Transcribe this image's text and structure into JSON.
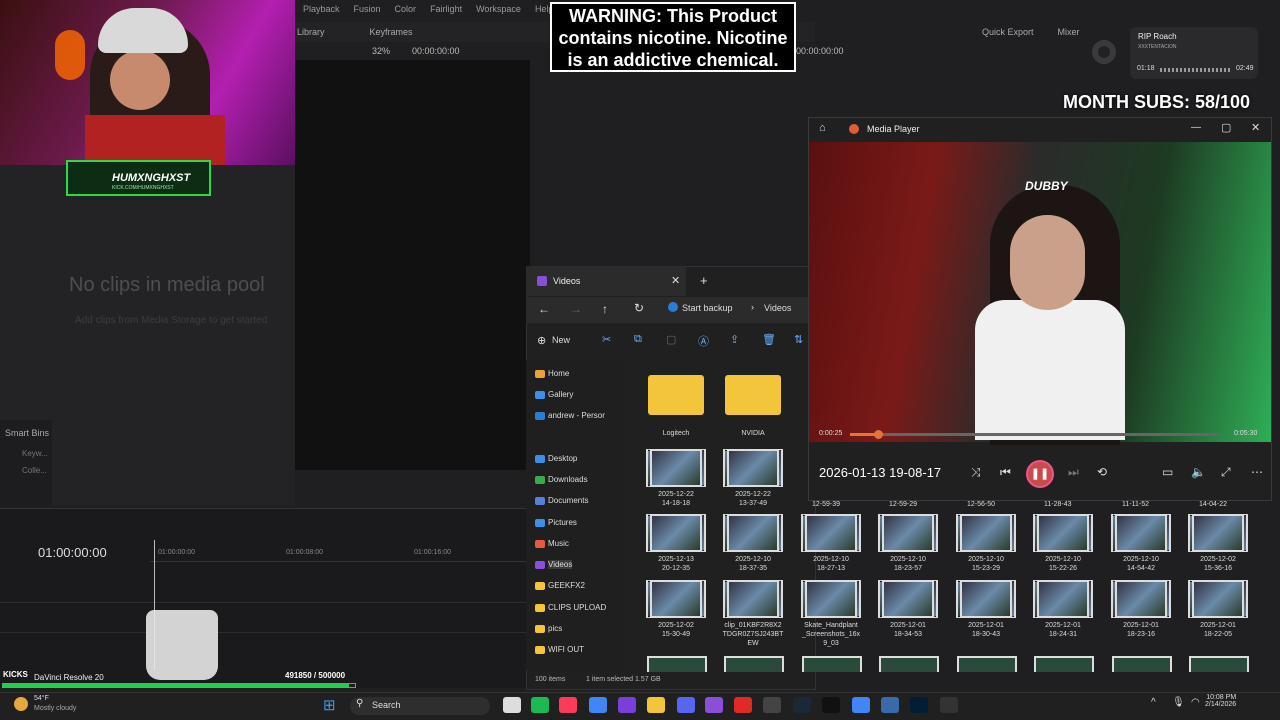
{
  "resolve": {
    "menu": [
      "Playback",
      "Fusion",
      "Color",
      "Fairlight",
      "Workspace",
      "Help"
    ],
    "toolbar": {
      "library": "Library",
      "keyframes": "Keyframes",
      "zoom": "32%",
      "timecode": "00:00:00:00"
    },
    "timecode2": "00:00:00:00",
    "quick_export": "Quick Export",
    "mixer": "Mixer",
    "media_pool_empty": "No clips in media pool",
    "media_pool_hint": "Add clips from Media Storage to get started",
    "smart_bins": "Smart Bins",
    "smart_bin_items": [
      "Keyw...",
      "Colle..."
    ],
    "timeline_tc": "01:00:00:00",
    "ruler": [
      "01:00:00:00",
      "01:00:08:00",
      "01:00:16:00"
    ],
    "app_name": "DaVinci Resolve 20"
  },
  "overlay": {
    "webcam_logo": "HUMXNGHXST",
    "webcam_logo_sub": "KICK.COM/HUMXNGHXST",
    "warning": "WARNING: This Product contains nicotine. Nicotine is an addictive chemical.",
    "month_subs": "MONTH SUBS: 58/100",
    "kick_label": "KICKS",
    "goal_counter": "491850 / 500000",
    "goal_progress": 0.9837
  },
  "spotify": {
    "title": "RIP Roach",
    "artist": "XXXTENTACION",
    "elapsed": "01:18",
    "duration": "02:49"
  },
  "media_player": {
    "title": "Media Player",
    "brand": "DUBBY",
    "current": "0:00:25",
    "duration": "0:05:30",
    "progress": 0.076,
    "file_name": "2026-01-13 19-08-17"
  },
  "explorer": {
    "tab_title": "Videos",
    "address": [
      "Start backup",
      "Videos"
    ],
    "new_label": "New",
    "nav": [
      {
        "label": "Home",
        "color": "#e8a33d"
      },
      {
        "label": "Gallery",
        "color": "#3d8ee8"
      },
      {
        "label": "andrew - Persor",
        "color": "#2b7cd3"
      },
      {
        "label": "Desktop",
        "color": "#3d8ee8"
      },
      {
        "label": "Downloads",
        "color": "#3da84e"
      },
      {
        "label": "Documents",
        "color": "#5a7fd8"
      },
      {
        "label": "Pictures",
        "color": "#3d8ee8"
      },
      {
        "label": "Music",
        "color": "#e85a3d"
      },
      {
        "label": "Videos",
        "color": "#8a4fd8"
      },
      {
        "label": "GEEKFX2",
        "color": "#f3c53a"
      },
      {
        "label": "CLIPS UPLOAD",
        "color": "#f3c53a"
      },
      {
        "label": "pics",
        "color": "#f3c53a"
      },
      {
        "label": "WIFI OUT",
        "color": "#f3c53a"
      }
    ],
    "folders": [
      "Logitech",
      "NVIDIA"
    ],
    "row1": [
      "2025-12-22\n14-18-18",
      "2025-12-22\n13-37-49"
    ],
    "row1_partial": [
      "12-59-39",
      "12-59-29",
      "12-56-50",
      "11-28-43",
      "11-11-52",
      "14-04-22"
    ],
    "row2": [
      "2025-12-13\n20-12-35",
      "2025-12-10\n18-37-35",
      "2025-12-10\n18-27-13",
      "2025-12-10\n18-23-57",
      "2025-12-10\n15-23-29",
      "2025-12-10\n15-22-26",
      "2025-12-10\n14-54-42",
      "2025-12-02\n15-36-16"
    ],
    "row3": [
      "2025-12-02\n15-30-49",
      "clip_01KBF2R8X2\nTDGR0Z7SJ243BT\nEW",
      "Skate_Handplant\n_Screenshots_16x\n9_03",
      "2025-12-01\n18-34-53",
      "2025-12-01\n18-30-43",
      "2025-12-01\n18-24-31",
      "2025-12-01\n18-23-16",
      "2025-12-01\n18-22-05"
    ],
    "status_count": "100 items",
    "status_selected": "1 item selected  1.57 GB"
  },
  "taskbar": {
    "temp": "54°F",
    "weather": "Mostly cloudy",
    "search": "Search",
    "time": "10:08 PM",
    "date": "2/14/2026"
  }
}
